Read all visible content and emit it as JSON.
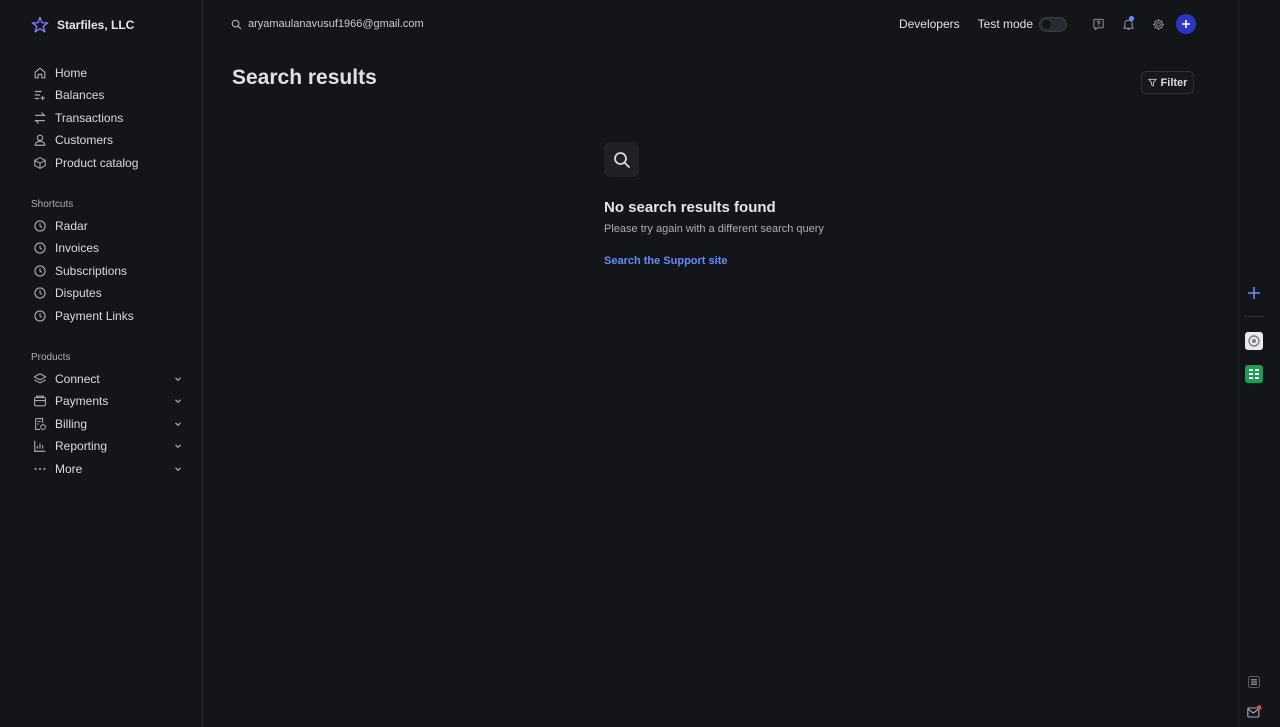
{
  "account": {
    "name": "Starfiles, LLC"
  },
  "nav": {
    "main": [
      {
        "label": "Home",
        "icon": "home-icon"
      },
      {
        "label": "Balances",
        "icon": "balances-icon"
      },
      {
        "label": "Transactions",
        "icon": "transactions-icon"
      },
      {
        "label": "Customers",
        "icon": "customer-icon"
      },
      {
        "label": "Product catalog",
        "icon": "cube-icon"
      }
    ],
    "shortcuts_label": "Shortcuts",
    "shortcuts": [
      {
        "label": "Radar",
        "icon": "clock-icon"
      },
      {
        "label": "Invoices",
        "icon": "clock-icon"
      },
      {
        "label": "Subscriptions",
        "icon": "clock-icon"
      },
      {
        "label": "Disputes",
        "icon": "clock-icon"
      },
      {
        "label": "Payment Links",
        "icon": "clock-icon"
      }
    ],
    "products_label": "Products",
    "products": [
      {
        "label": "Connect",
        "icon": "layers-icon"
      },
      {
        "label": "Payments",
        "icon": "wallet-icon"
      },
      {
        "label": "Billing",
        "icon": "billing-icon"
      },
      {
        "label": "Reporting",
        "icon": "bar-chart-icon"
      },
      {
        "label": "More",
        "icon": "more-icon"
      }
    ]
  },
  "topbar": {
    "search_value": "aryamaulanavusuf1966@gmail.com",
    "developers": "Developers",
    "test_mode": "Test mode"
  },
  "main": {
    "title": "Search results",
    "filter_label": "Filter",
    "empty_title": "No search results found",
    "empty_subtitle": "Please try again with a different search query",
    "support_link": "Search the Support site"
  },
  "colors": {
    "accent": "#5f8dff",
    "avatar": "#2a35c4",
    "background": "#141519"
  }
}
